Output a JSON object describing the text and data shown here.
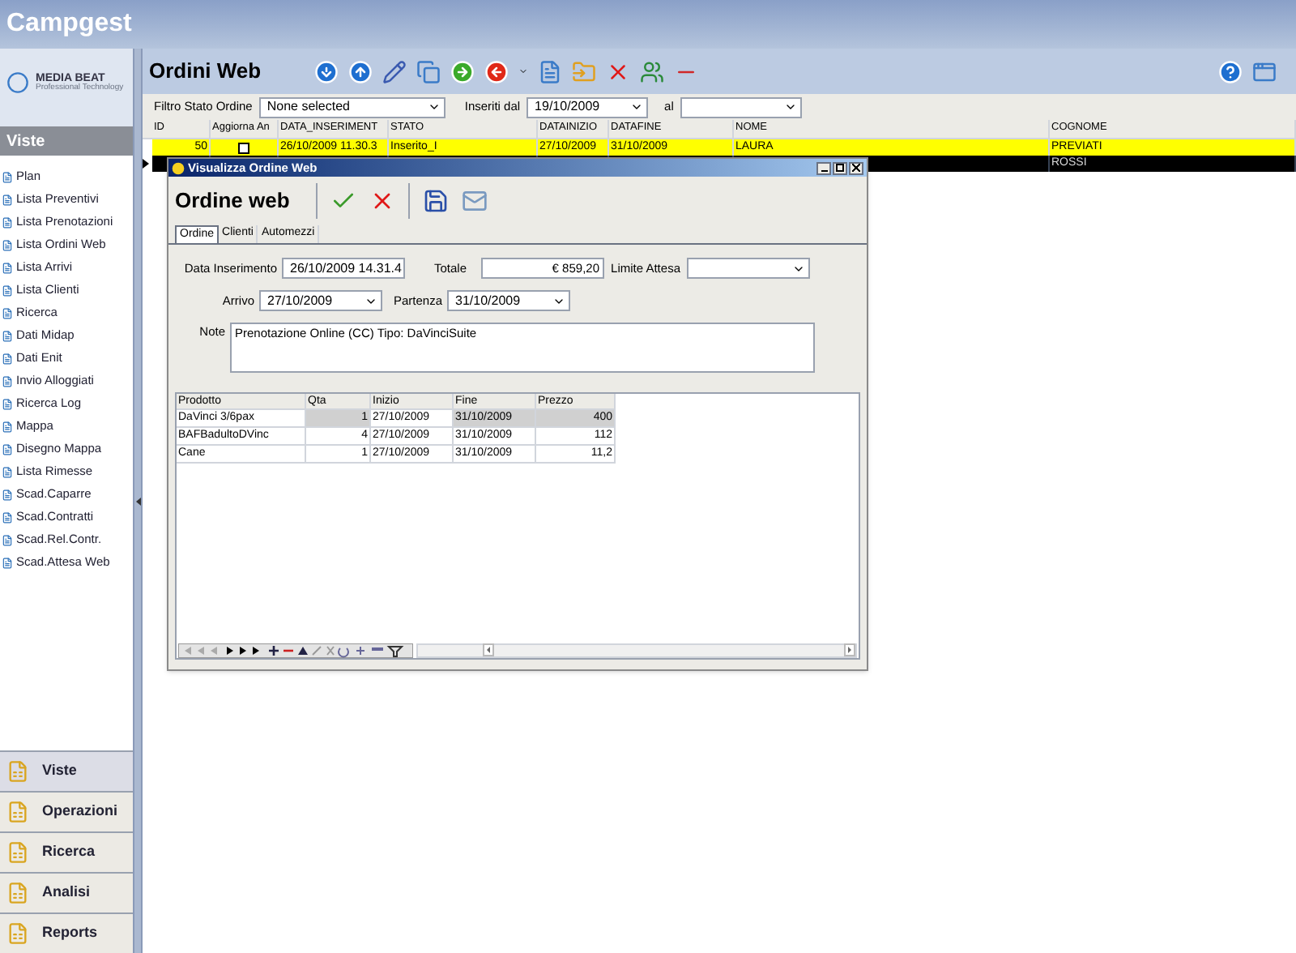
{
  "app_title": "Campgest",
  "logo": {
    "name": "MEDIA BEAT",
    "tagline": "Professional Technology"
  },
  "sidebar": {
    "header": "Viste",
    "items": [
      "Plan",
      "Lista Preventivi",
      "Lista Prenotazioni",
      "Lista Ordini Web",
      "Lista Arrivi",
      "Lista Clienti",
      "Ricerca",
      "Dati Midap",
      "Dati Enit",
      "Invio Alloggiati",
      "Ricerca Log",
      "Mappa",
      "Disegno Mappa",
      "Lista Rimesse",
      "Scad.Caparre",
      "Scad.Contratti",
      "Scad.Rel.Contr.",
      "Scad.Attesa Web"
    ],
    "sections": [
      {
        "label": "Viste",
        "selected": true
      },
      {
        "label": "Operazioni",
        "selected": false
      },
      {
        "label": "Ricerca",
        "selected": false
      },
      {
        "label": "Analisi",
        "selected": false
      },
      {
        "label": "Reports",
        "selected": false
      }
    ]
  },
  "page": {
    "title": "Ordini Web",
    "filters": {
      "stato_label": "Filtro Stato Ordine",
      "stato_value": "None selected",
      "dal_label": "Inseriti dal",
      "dal_value": "19/10/2009",
      "al_label": "al"
    },
    "table": {
      "columns": [
        "ID",
        "Aggiorna An",
        "DATA_INSERIMENT",
        "STATO",
        "DATAINIZIO",
        "DATAFINE",
        "NOME",
        "COGNOME"
      ],
      "rows": [
        {
          "color": "#ffff00",
          "selected": false,
          "id": "50",
          "checked": false,
          "data_inserimento": "26/10/2009 11.30.3",
          "stato": "Inserito_I",
          "datainizio": "27/10/2009",
          "datafine": "31/10/2009",
          "nome": "LAURA",
          "cognome": "PREVIATI"
        },
        {
          "color": "#000000",
          "selected": true,
          "cognome": "ROSSI"
        }
      ]
    }
  },
  "dialog": {
    "title": "Visualizza Ordine Web",
    "heading": "Ordine web",
    "tabs": [
      {
        "label": "Ordine",
        "selected": true
      },
      {
        "label": "Clienti",
        "selected": false
      },
      {
        "label": "Automezzi",
        "selected": false
      }
    ],
    "fields": {
      "data_label": "Data Inserimento",
      "data_value": "26/10/2009 14.31.4",
      "totale_label": "Totale",
      "totale_value": "€ 859,20",
      "limite_label": "Limite Attesa",
      "arrivo_label": "Arrivo",
      "arrivo_value": "27/10/2009",
      "partenza_label": "Partenza",
      "partenza_value": "31/10/2009",
      "note_label": "Note",
      "note_value": "Prenotazione Online (CC) Tipo: DaVinciSuite"
    },
    "grid": {
      "columns": [
        "Prodotto",
        "Qta",
        "Inizio",
        "Fine",
        "Prezzo"
      ],
      "rows": [
        {
          "selected": true,
          "cells": [
            "DaVinci 3/6pax",
            "1",
            "27/10/2009",
            "31/10/2009",
            "400"
          ]
        },
        {
          "selected": false,
          "cells": [
            "BAFBadultoDVinc",
            "4",
            "27/10/2009",
            "31/10/2009",
            "112"
          ]
        },
        {
          "selected": false,
          "cells": [
            "Cane",
            "1",
            "27/10/2009",
            "31/10/2009",
            "11,2"
          ]
        }
      ]
    }
  }
}
